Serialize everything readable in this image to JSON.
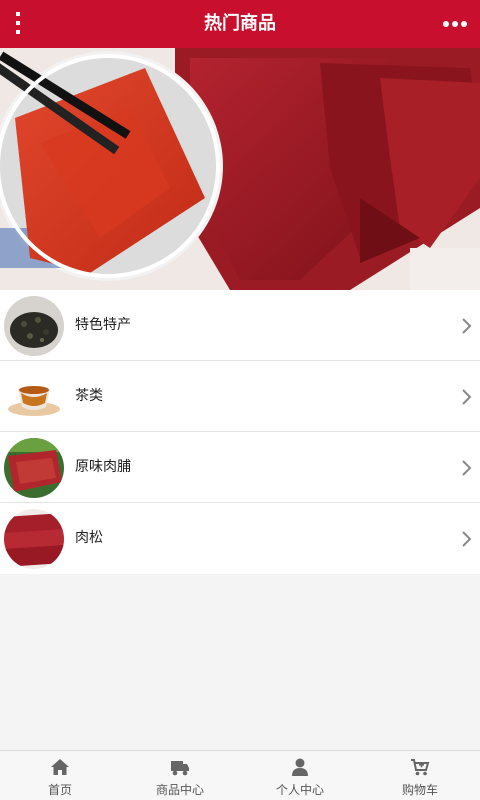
{
  "header": {
    "title": "热门商品",
    "menu_icon": "vertical-dots-icon",
    "more_icon": "horizontal-dots-icon",
    "bar_color": "#c8102e"
  },
  "banner": {
    "slide_count": 2,
    "active_slide": 2
  },
  "categories": [
    {
      "label": "特色特产",
      "icon": "chevron-right-icon"
    },
    {
      "label": "茶类",
      "icon": "chevron-right-icon"
    },
    {
      "label": "原味肉脯",
      "icon": "chevron-right-icon"
    },
    {
      "label": "肉松",
      "icon": "chevron-right-icon"
    }
  ],
  "tabbar": {
    "items": [
      {
        "label": "首页",
        "icon": "home-icon"
      },
      {
        "label": "商品中心",
        "icon": "truck-icon"
      },
      {
        "label": "个人中心",
        "icon": "user-icon"
      },
      {
        "label": "购物车",
        "icon": "cart-icon"
      }
    ]
  }
}
